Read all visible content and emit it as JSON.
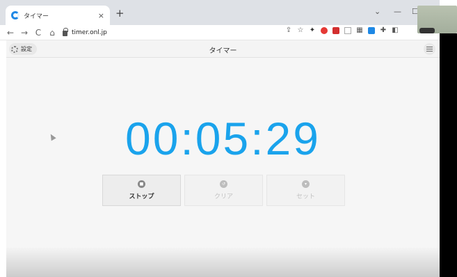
{
  "browser": {
    "tab_title": "タイマー",
    "tab_close": "×",
    "new_tab": "+",
    "url": "timer.onl.jp",
    "window_minimize": "—",
    "window_chevron": "⌄",
    "window_maximize": "☐"
  },
  "app": {
    "settings_label": "設定",
    "title": "タイマー",
    "timer_value": "00:05:29",
    "buttons": {
      "stop": "ストップ",
      "clear": "クリア",
      "set": "セット"
    }
  },
  "colors": {
    "timer": "#1aa3ec",
    "chrome": "#dee1e6"
  }
}
